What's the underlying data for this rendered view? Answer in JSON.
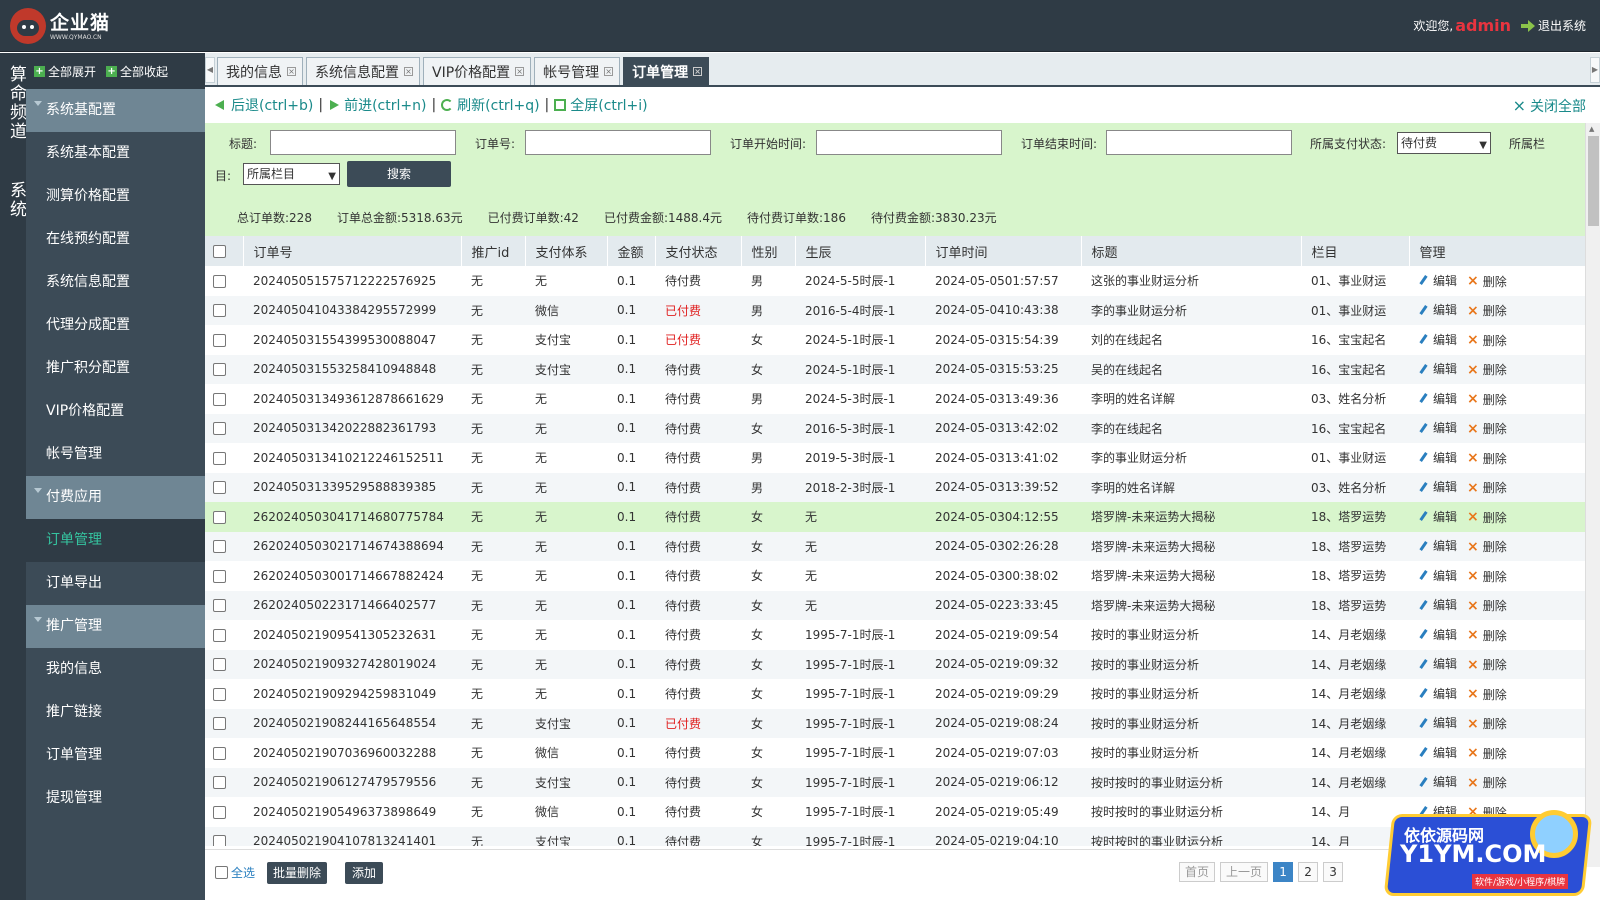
{
  "header": {
    "logo_name": "企业猫",
    "logo_url": "WWW.QYMAO.CN",
    "welcome": "欢迎您,",
    "user": "admin",
    "logout": "退出系统"
  },
  "vstrip": [
    "算命频道",
    "系统"
  ],
  "sidebar": {
    "expand_all": "全部展开",
    "collapse_all": "全部收起",
    "groups": [
      {
        "label": "系统基配置",
        "items": [
          "系统基本配置",
          "测算价格配置",
          "在线预约配置",
          "系统信息配置",
          "代理分成配置",
          "推广积分配置",
          "VIP 价格配置",
          "帐号管理"
        ]
      },
      {
        "label": "付费应用",
        "items": [
          "订单管理",
          "订单导出"
        ]
      },
      {
        "label": "推广管理",
        "items": [
          "我的信息",
          "推广链接",
          "订单管理",
          "提现管理"
        ]
      }
    ]
  },
  "tabs": [
    {
      "label": "我的信息"
    },
    {
      "label": "系统信息配置"
    },
    {
      "label": "VIP 价格配置"
    },
    {
      "label": "帐号管理"
    },
    {
      "label": "订单管理"
    }
  ],
  "nav": {
    "back": "后退(ctrl+b)",
    "forward": "前进(ctrl+n)",
    "refresh": "刷新(ctrl+q)",
    "fullscreen": "全屏(ctrl+i)",
    "close_all": "关闭全部"
  },
  "filter": {
    "title_label": "标题:",
    "order_label": "订单号:",
    "start_label": "订单开始时间:",
    "end_label": "订单结束时间:",
    "pay_status_label": "所属支付状态:",
    "pay_status_value": "待付费",
    "column_label_a": "所属栏",
    "column_label_b": "目:",
    "column_value": "所属栏目",
    "search_button": "搜索"
  },
  "stats": {
    "total_orders": "总订单数:228",
    "total_amount": "订单总金额:5318.63 元",
    "paid_orders": "已付费订单数:42",
    "paid_amount": "已付费金额:1488.4 元",
    "unpaid_orders": "待付费订单数:186",
    "unpaid_amount": "待付费金额:3830.23 元"
  },
  "table": {
    "headers": [
      "订单号",
      "推广id",
      "支付体系",
      "金额",
      "支付状态",
      "性别",
      "生辰",
      "订单时间",
      "标题",
      "栏目",
      "管理"
    ],
    "edit_label": "编辑",
    "delete_label": "删除",
    "rows": [
      [
        "20240505157571222257692 5",
        "无",
        "无",
        "0.1",
        "待付费",
        "男",
        "2024-5-5时辰-1",
        "2024-05-05 01:57:57",
        "这张的事业财运分析",
        "01、事业财运"
      ],
      [
        "20240504104338429557299 9",
        "无",
        "微信",
        "0.1",
        "已付费",
        "男",
        "2016-5-4时辰-1",
        "2024-05-04 10:43:38",
        "李的事业财运分析",
        "01、事业财运"
      ],
      [
        "20240503155439953008804 7",
        "无",
        "支付宝",
        "0.1",
        "已付费",
        "女",
        "2024-5-1时辰-1",
        "2024-05-03 15:54:39",
        "刘的在线起名",
        "16、宝宝起名"
      ],
      [
        "20240503155325841094884 8",
        "无",
        "支付宝",
        "0.1",
        "待付费",
        "女",
        "2024-5-1时辰-1",
        "2024-05-03 15:53:25",
        "吴的在线起名",
        "16、宝宝起名"
      ],
      [
        "20240503134936128786616 29",
        "无",
        "无",
        "0.1",
        "待付费",
        "男",
        "2024-5-3时辰-1",
        "2024-05-03 13:49:36",
        "李明的姓名详解",
        "03、姓名分析"
      ],
      [
        "20240503134202288236179 3",
        "无",
        "无",
        "0.1",
        "待付费",
        "女",
        "2016-5-3时辰-1",
        "2024-05-03 13:42:02",
        "李的在线起名",
        "16、宝宝起名"
      ],
      [
        "20240503134102122461525 11",
        "无",
        "无",
        "0.1",
        "待付费",
        "男",
        "2019-5-3时辰-1",
        "2024-05-03 13:41:02",
        "李的事业财运分析",
        "01、事业财运"
      ],
      [
        "20240503133952958883938 5",
        "无",
        "无",
        "0.1",
        "待付费",
        "男",
        "2018-2-3时辰-1",
        "2024-05-03 13:39:52",
        "李明的姓名详解",
        "03、姓名分析"
      ],
      [
        "26202405030417146807757 84",
        "无",
        "无",
        "0.1",
        "待付费",
        "女",
        "无",
        "2024-05-03 04:12:55",
        "塔罗牌-未来运势大揭秘",
        "18、塔罗运势"
      ],
      [
        "26202405030217146743886 94",
        "无",
        "无",
        "0.1",
        "待付费",
        "女",
        "无",
        "2024-05-03 02:26:28",
        "塔罗牌-未来运势大揭秘",
        "18、塔罗运势"
      ],
      [
        "26202405030017146678824 24",
        "无",
        "无",
        "0.1",
        "待付费",
        "女",
        "无",
        "2024-05-03 00:38:02",
        "塔罗牌-未来运势大揭秘",
        "18、塔罗运势"
      ],
      [
        "26202405022317146640257 7",
        "无",
        "无",
        "0.1",
        "待付费",
        "女",
        "无",
        "2024-05-02 23:33:45",
        "塔罗牌-未来运势大揭秘",
        "18、塔罗运势"
      ],
      [
        "20240502190954130523263 1",
        "无",
        "无",
        "0.1",
        "待付费",
        "女",
        "1995-7-1时辰-1",
        "2024-05-02 19:09:54",
        "按时的事业财运分析",
        "14、月老姻缘"
      ],
      [
        "20240502190932742801902 4",
        "无",
        "无",
        "0.1",
        "待付费",
        "女",
        "1995-7-1时辰-1",
        "2024-05-02 19:09:32",
        "按时的事业财运分析",
        "14、月老姻缘"
      ],
      [
        "20240502190929425983104 9",
        "无",
        "无",
        "0.1",
        "待付费",
        "女",
        "1995-7-1时辰-1",
        "2024-05-02 19:09:29",
        "按时的事业财运分析",
        "14、月老姻缘"
      ],
      [
        "20240502190824416564855 4",
        "无",
        "支付宝",
        "0.1",
        "已付费",
        "女",
        "1995-7-1时辰-1",
        "2024-05-02 19:08:24",
        "按时的事业财运分析",
        "14、月老姻缘"
      ],
      [
        "20240502190703696003228 8",
        "无",
        "微信",
        "0.1",
        "待付费",
        "女",
        "1995-7-1时辰-1",
        "2024-05-02 19:07:03",
        "按时的事业财运分析",
        "14、月老姻缘"
      ],
      [
        "20240502190612747957955 6",
        "无",
        "支付宝",
        "0.1",
        "待付费",
        "女",
        "1995-7-1时辰-1",
        "2024-05-02 19:06:12",
        "按时按时的事业财运分析",
        "14、月老姻缘"
      ],
      [
        "20240502190549637389864 9",
        "无",
        "微信",
        "0.1",
        "待付费",
        "女",
        "1995-7-1时辰-1",
        "2024-05-02 19:05:49",
        "按时按时的事业财运分析",
        "14、月"
      ],
      [
        "20240502190410781324140 1",
        "无",
        "支付宝",
        "0.1",
        "待付费",
        "女",
        "1995-7-1时辰-1",
        "2024-05-02 19:04:10",
        "按时按时的事业财运分析",
        "14、月"
      ]
    ]
  },
  "footer": {
    "select_all": "全选",
    "batch_delete": "批量删除",
    "add": "添加",
    "first": "首页",
    "prev": "上一页",
    "pages": [
      "1",
      "2",
      "3"
    ]
  },
  "watermark": {
    "line1": "依依源码网",
    "line2": "Y1YM.COM",
    "line3": "软件/游戏/小程序/棋牌"
  },
  "colors": {
    "header_bg": "#2f3b45",
    "sidebar_bg": "#3c4b57",
    "group_bg": "#6f8694",
    "filter_bg": "#d8f5cc",
    "active_text": "#35c4a0",
    "paid_text": "#e02020",
    "user_text": "#e8343f"
  }
}
